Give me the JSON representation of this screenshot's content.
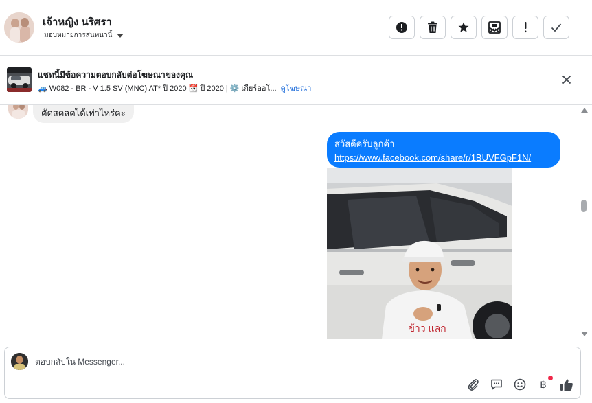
{
  "header": {
    "contact_name": "เจ้าหญิง นริศรา",
    "assign_label": "มอบหมายการสนทนานี้",
    "actions": [
      {
        "icon": "alert-circle-icon",
        "label": "Mark as spam"
      },
      {
        "icon": "trash-icon",
        "label": "Delete"
      },
      {
        "icon": "star-icon",
        "label": "Star"
      },
      {
        "icon": "mail-unread-icon",
        "label": "Mark as unread"
      },
      {
        "icon": "exclamation-icon",
        "label": "Follow up"
      },
      {
        "icon": "check-icon",
        "label": "Done"
      }
    ]
  },
  "ad": {
    "title": "แชทนี้มีข้อความตอบกลับต่อโฆษณาของคุณ",
    "car_emoji": "🚙",
    "detail": "W082 - BR - V 1.5 SV (MNC) AT* ปี 2020",
    "calendar_emoji": "📆",
    "year": "ปี 2020 |",
    "gear_emoji": "⚙️",
    "gear_text": "เกียร์ออโ...",
    "view_ad_link": "ดูโฆษณา"
  },
  "messages": {
    "incoming_text": "ตัดสดลดได้เท่าไหร่คะ",
    "outgoing_greeting": "สวัสดีครับลูกค้า",
    "outgoing_url": "https://www.facebook.com/share/r/1BUVFGpF1N/",
    "photo_caption": "ข้าว แลก"
  },
  "composer": {
    "placeholder": "ตอบกลับใน Messenger...",
    "tools": [
      "attach-icon",
      "saved-reply-icon",
      "emoji-icon",
      "baht-icon",
      "thumbs-up-icon"
    ],
    "baht_symbol": "฿"
  },
  "colors": {
    "accent_blue": "#0a7cff",
    "link_blue": "#216fdb",
    "notification_red": "#f02849"
  }
}
